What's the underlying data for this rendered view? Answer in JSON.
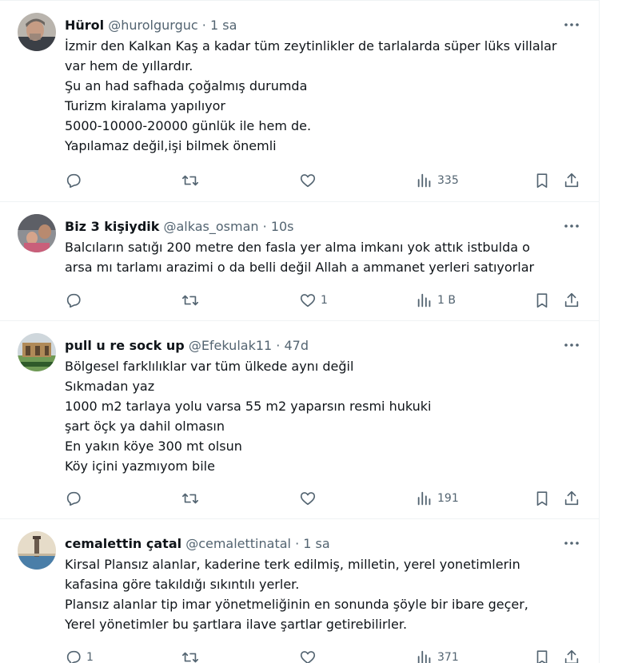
{
  "tweets": [
    {
      "name": "Hürol",
      "handle": "@hurolgurguc",
      "dot": "·",
      "time": "1 sa",
      "lines": [
        "İzmir den Kalkan Kaş a kadar tüm zeytinlikler de tarlalarda süper lüks villalar",
        "var hem de yıllardır.",
        "Şu an had safhada çoğalmış durumda",
        "Turizm kiralama yapılıyor",
        "5000-10000-20000 günlük ile hem de.",
        "Yapılamaz değil,işi bilmek önemli"
      ],
      "replies": "",
      "retweets": "",
      "likes": "",
      "views": "335"
    },
    {
      "name": "Biz 3 kişiydik",
      "handle": "@alkas_osman",
      "dot": "·",
      "time": "10s",
      "lines": [
        "Balcıların satığı 200 metre den fasla yer alma imkanı yok attık istbulda  o",
        "arsa mı tarlamı arazimi o da belli değil  Allah a ammanet yerleri satıyorlar"
      ],
      "replies": "",
      "retweets": "",
      "likes": "1",
      "views": "1 B"
    },
    {
      "name": "pull u re sock up",
      "handle": "@Efekulak11",
      "dot": "·",
      "time": "47d",
      "lines": [
        "Bölgesel farklılıklar var tüm ülkede aynı değil",
        "Sıkmadan yaz",
        "1000 m2 tarlaya yolu varsa 55 m2 yaparsın resmi hukuki",
        "şart öçk ya dahil olmasın",
        "En yakın köye 300 mt olsun",
        "Köy içini yazmıyom bile"
      ],
      "replies": "",
      "retweets": "",
      "likes": "",
      "views": "191"
    },
    {
      "name": "cemalettin çatal",
      "handle": "@cemalettinatal",
      "dot": "·",
      "time": "1 sa",
      "lines": [
        "Kirsal Plansız alanlar, kaderine terk edilmiş, milletin, yerel yonetimlerin",
        "kafasina göre takıldığı sıkıntılı yerler.",
        "Plansız alanlar tip imar yönetmeliğinin en sonunda şöyle bir ibare geçer,",
        "Yerel yönetimler bu şartlara ilave şartlar getirebilirler."
      ],
      "replies": "1",
      "retweets": "",
      "likes": "",
      "views": "371"
    }
  ],
  "icons": {
    "more": "more-icon",
    "reply": "reply-icon",
    "retweet": "retweet-icon",
    "like": "heart-icon",
    "views": "views-chart-icon",
    "bookmark": "bookmark-icon",
    "share": "share-icon"
  },
  "colors": {
    "text": "#0f1419",
    "secondary": "#536471",
    "divider": "#eff3f4"
  }
}
